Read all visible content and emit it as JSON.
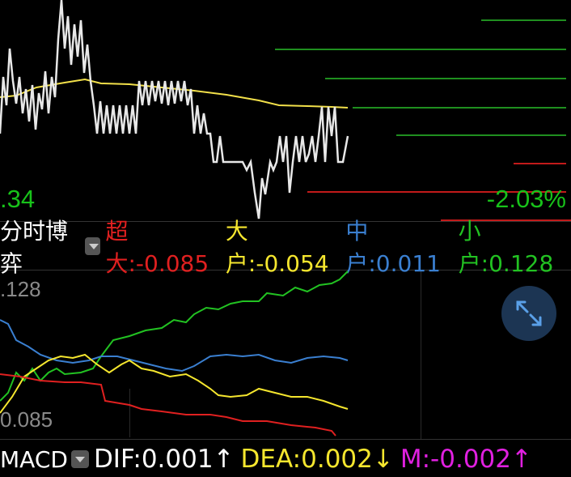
{
  "price_panel": {
    "price_low": ".34",
    "pct_change": "-2.03%"
  },
  "flow_legend": {
    "selector_label": "分时博弈",
    "super_large": "超大:-0.085",
    "large": "大户:-0.054",
    "medium": "中户:0.011",
    "small": "小户:0.128",
    "colors": {
      "super_large": "#e02020",
      "large": "#f5e62e",
      "medium": "#3a7fd0",
      "small": "#22c222"
    }
  },
  "flow_axis": {
    "top_label": ".128",
    "bottom_label": "0.085"
  },
  "macd_legend": {
    "selector_label": "MACD",
    "dif": "DIF:0.001↑",
    "dea": "DEA:0.002↓",
    "m": "M:-0.002↑",
    "colors": {
      "dif": "#ffffff",
      "dea": "#f5e62e",
      "m": "#e020e0"
    }
  },
  "icons": {
    "expand": "expand-arrows-icon",
    "dropdown": "chevron-down-icon"
  }
}
